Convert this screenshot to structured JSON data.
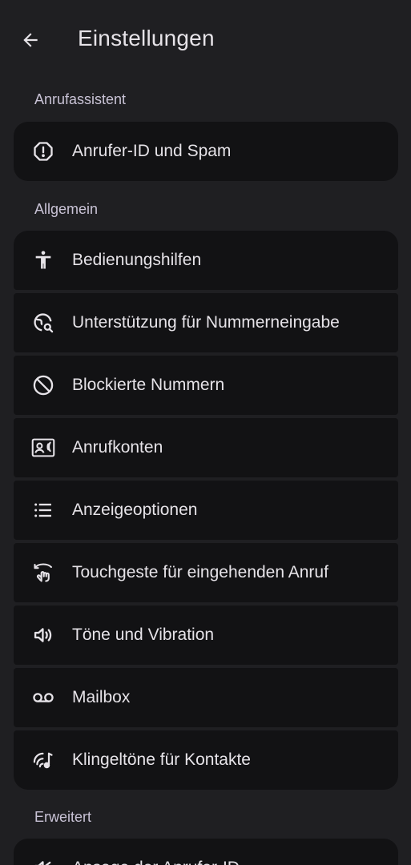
{
  "header": {
    "title": "Einstellungen",
    "back_icon": "arrow-back-icon"
  },
  "sections": {
    "anruf": {
      "title": "Anrufassistent",
      "items": [
        {
          "label": "Anrufer-ID und Spam",
          "icon": "alert-octagon-icon"
        }
      ]
    },
    "allgemein": {
      "title": "Allgemein",
      "items": [
        {
          "label": "Bedienungshilfen",
          "icon": "accessibility-icon"
        },
        {
          "label": "Unterstützung für Nummerneingabe",
          "icon": "globe-search-icon"
        },
        {
          "label": "Blockierte Nummern",
          "icon": "block-icon"
        },
        {
          "label": "Anrufkonten",
          "icon": "contact-phone-icon"
        },
        {
          "label": "Anzeigeoptionen",
          "icon": "list-icon"
        },
        {
          "label": "Touchgeste für eingehenden Anruf",
          "icon": "swipe-gesture-icon"
        },
        {
          "label": "Töne und Vibration",
          "icon": "volume-icon"
        },
        {
          "label": "Mailbox",
          "icon": "voicemail-icon"
        },
        {
          "label": "Klingeltöne für Kontakte",
          "icon": "ringtone-icon"
        }
      ]
    },
    "erweitert": {
      "title": "Erweitert",
      "items": [
        {
          "label": "Ansage der Anrufer-ID",
          "icon": "announce-icon"
        }
      ]
    }
  },
  "colors": {
    "background": "#1f1f22",
    "card": "#121214",
    "text": "#e6e3e8",
    "section": "#c9c3d6"
  }
}
